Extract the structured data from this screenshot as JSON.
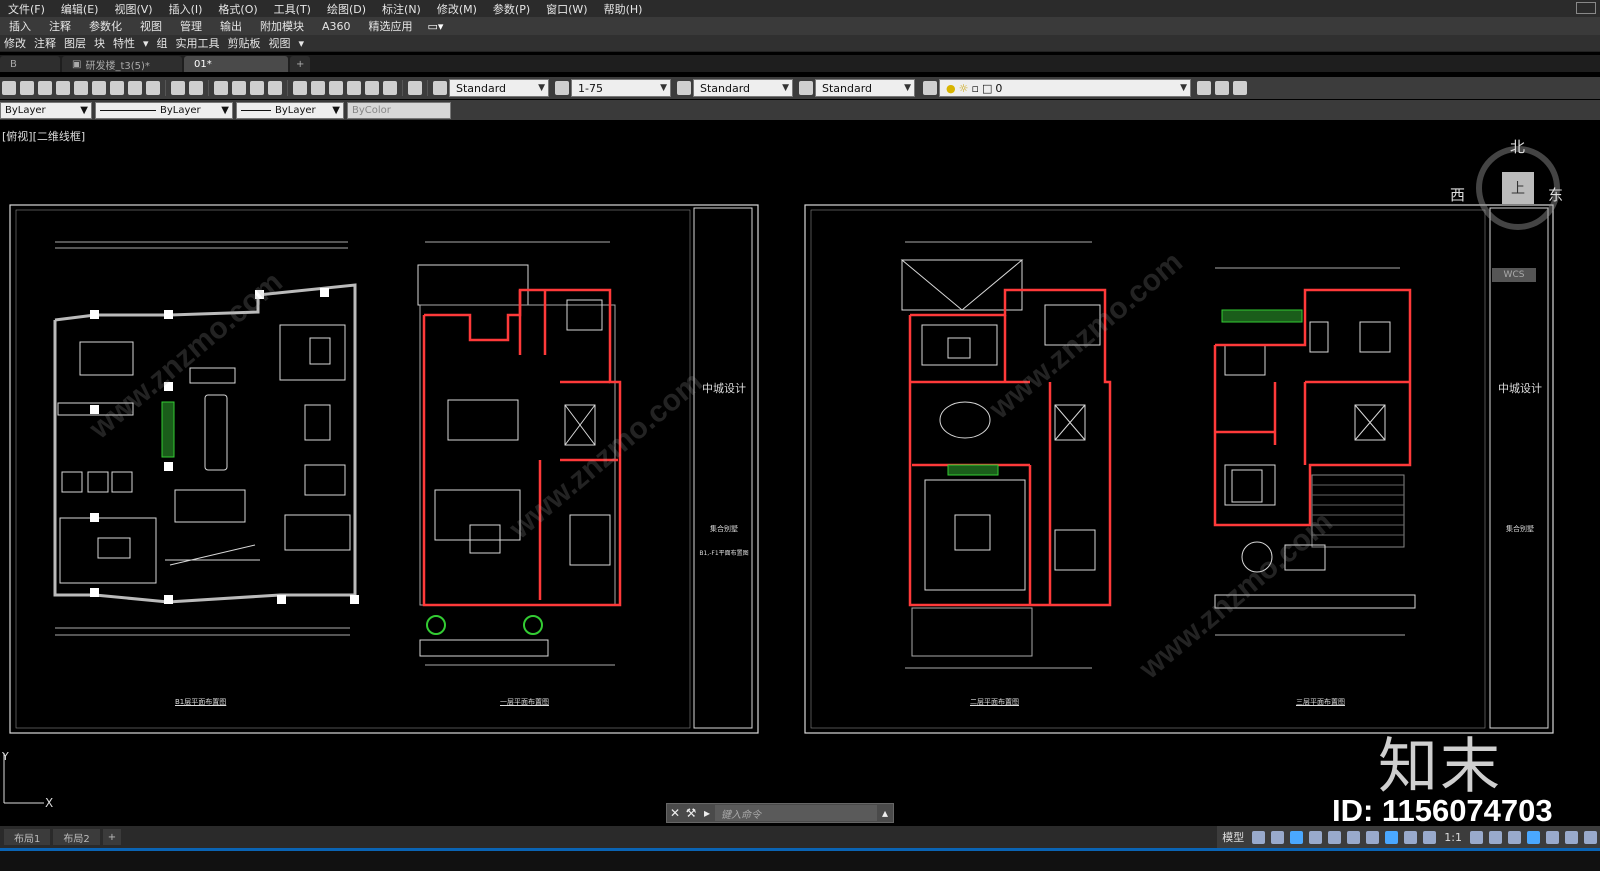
{
  "menubar": {
    "items": [
      "文件(F)",
      "编辑(E)",
      "视图(V)",
      "插入(I)",
      "格式(O)",
      "工具(T)",
      "绘图(D)",
      "标注(N)",
      "修改(M)",
      "参数(P)",
      "窗口(W)",
      "帮助(H)"
    ]
  },
  "ribbon": {
    "tabs": [
      "插入",
      "注释",
      "参数化",
      "视图",
      "管理",
      "输出",
      "附加模块",
      "A360",
      "精选应用"
    ]
  },
  "panels": {
    "items": [
      "修改",
      "注释",
      "图层",
      "块",
      "特性",
      "组",
      "实用工具",
      "剪贴板",
      "视图"
    ]
  },
  "doc_tabs": {
    "items": [
      "B",
      "研发楼_t3(5)*",
      "01*"
    ],
    "active_index": 2
  },
  "toolbar": {
    "text_style": "Standard",
    "dim_scale": "1-75",
    "table_style": "Standard",
    "mleader_style": "Standard",
    "layer": "0"
  },
  "properties": {
    "layer": "ByLayer",
    "linetype": "ByLayer",
    "lineweight": "ByLayer",
    "color": "ByColor"
  },
  "viewport_label": "[俯视][二维线框]",
  "viewcube": {
    "north": "北",
    "west": "西",
    "east": "东",
    "face": "上",
    "wcs": "WCS"
  },
  "title_block": {
    "company": "中城设计",
    "project": "集合别墅",
    "sheet": "B1,-F1平面布置图"
  },
  "plans": {
    "plan1_title": "B1层平面布置图",
    "plan2_title": "一层平面布置图",
    "plan3_title": "二层平面布置图",
    "plan4_title": "三层平面布置图"
  },
  "command": {
    "placeholder": "键入命令"
  },
  "layouts": {
    "items": [
      "布局1",
      "布局2"
    ]
  },
  "status": {
    "model_label": "模型",
    "scale": "1:1"
  },
  "watermark": {
    "brand": "知末",
    "id": "ID: 1156074703"
  },
  "colors": {
    "canvas": "#000000",
    "wall": "#ff3a3a",
    "line": "#d8d8d8",
    "plant": "#33cc33",
    "accent": "#0a64b4"
  }
}
